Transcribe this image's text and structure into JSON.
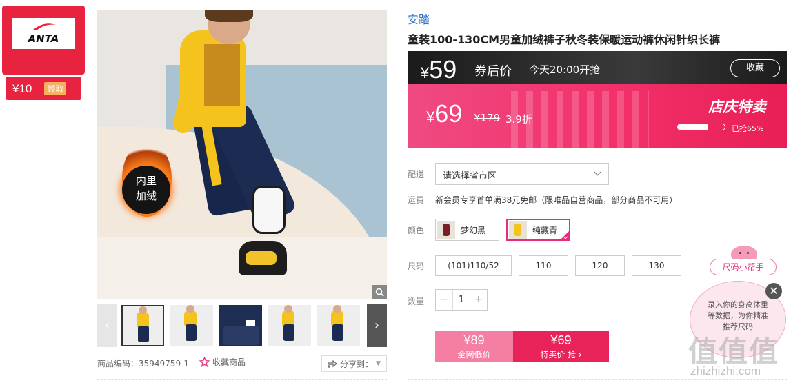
{
  "coupon": {
    "brand_logo": "ANTA",
    "value": "¥10",
    "action": "领取"
  },
  "gallery": {
    "main_badge": "内里\n加绒",
    "thumbnails": [
      "thumb-1",
      "thumb-2",
      "thumb-3",
      "thumb-4",
      "thumb-5"
    ],
    "product_code": "商品编码：35949759-1",
    "favorite": "收藏商品",
    "share": "分享到："
  },
  "product": {
    "brand": "安踏",
    "title": "童装100-130CM男童加绒裤子秋冬装保暖运动裤休闲针织长裤"
  },
  "promo": {
    "coupon_price_symbol": "¥",
    "coupon_price": "59",
    "coupon_price_label": "券后价",
    "start_time": "今天20:00开抢",
    "collect": "收藏",
    "price_symbol": "¥",
    "price": "69",
    "original_price": "¥179",
    "discount": "3.9折",
    "event_name": "店庆特卖",
    "sold_label": "已抢65%",
    "sold_fraction": 0.65
  },
  "options": {
    "delivery_label": "配送",
    "delivery_placeholder": "请选择省市区",
    "shipping_label": "运费",
    "shipping_text": "新会员专享首单满38元免邮（限唯品自营商品，部分商品不可用）",
    "color_label": "颜色",
    "colors": [
      {
        "name": "梦幻黑",
        "selected": false
      },
      {
        "name": "纯藏青",
        "selected": true
      }
    ],
    "size_label": "尺码",
    "sizes": [
      "(101)110/52",
      "110",
      "120",
      "130"
    ],
    "quantity_label": "数量",
    "quantity": "1",
    "minus": "−",
    "plus": "+"
  },
  "buy": {
    "market_price": "¥89",
    "market_label": "全网低价",
    "sale_price": "¥69",
    "sale_label": "特卖价 抢 ›"
  },
  "helper": {
    "tag": "尺码小帮手",
    "text": "录入你的身高体重等数据，为你精准推荐尺码",
    "close": "✕"
  },
  "watermark": {
    "mark": "值值值",
    "url": "zhizhizhi.com"
  },
  "colors": {
    "accent": "#e8235a",
    "brand_blue": "#2f73c4",
    "coupon_red": "#e8233f"
  }
}
